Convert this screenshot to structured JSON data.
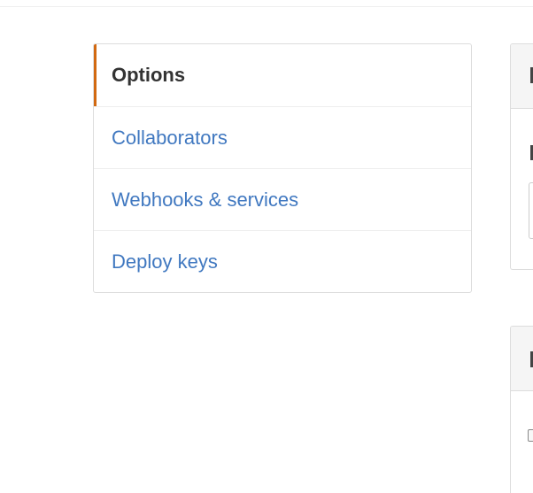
{
  "settings_menu": {
    "items": [
      {
        "label": "Options",
        "selected": true
      },
      {
        "label": "Collaborators",
        "selected": false
      },
      {
        "label": "Webhooks & services",
        "selected": false
      },
      {
        "label": "Deploy keys",
        "selected": false
      }
    ]
  },
  "colors": {
    "accent": "#d26911",
    "link": "#4078c0",
    "selected_text": "#333333",
    "border": "#dddddd",
    "panel_header_bg": "#f5f5f5"
  }
}
